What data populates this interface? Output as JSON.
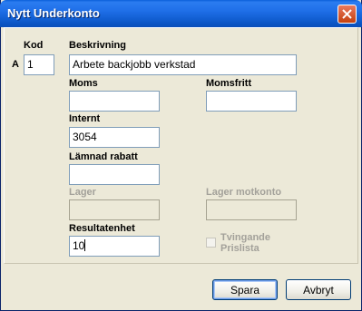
{
  "window": {
    "title": "Nytt Underkonto"
  },
  "form": {
    "row_marker": "A",
    "kod": {
      "label": "Kod",
      "value": "1"
    },
    "beskrivning": {
      "label": "Beskrivning",
      "value": "Arbete backjobb verkstad"
    },
    "moms": {
      "label": "Moms",
      "value": ""
    },
    "momsfritt": {
      "label": "Momsfritt",
      "value": ""
    },
    "internt": {
      "label": "Internt",
      "value": "3054"
    },
    "lamnad_rabatt": {
      "label": "Lämnad rabatt",
      "value": ""
    },
    "lager": {
      "label": "Lager",
      "value": "",
      "disabled": true
    },
    "lager_motkonto": {
      "label": "Lager motkonto",
      "value": "",
      "disabled": true
    },
    "resultatenhet": {
      "label": "Resultatenhet",
      "value": "10"
    },
    "tvingande_prislista": {
      "label_line1": "Tvingande",
      "label_line2": "Prislista",
      "checked": false,
      "disabled": true
    }
  },
  "buttons": {
    "save": "Spara",
    "cancel": "Avbryt"
  },
  "icons": {
    "close": "close-icon"
  },
  "colors": {
    "titlebar": "#0b56c6",
    "window_bg": "#ece9d8",
    "close_button": "#c4400f"
  }
}
